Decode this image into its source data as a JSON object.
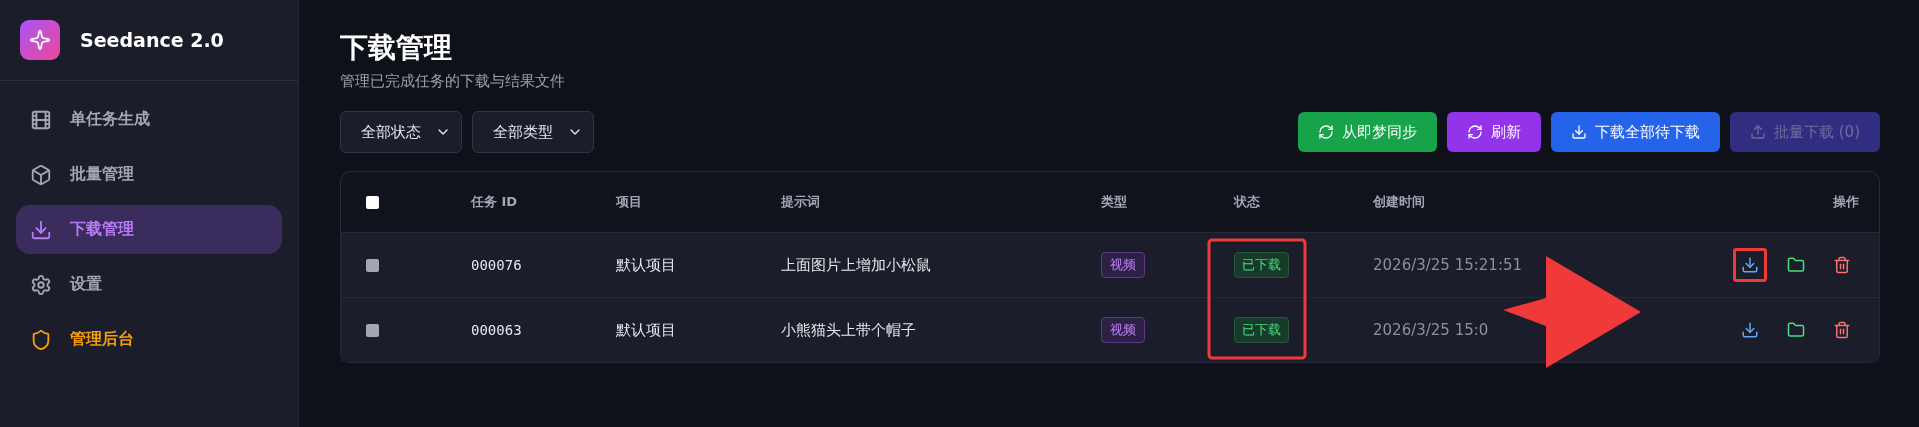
{
  "sidebar": {
    "app_name": "Seedance 2.0",
    "items": [
      {
        "label": "单任务生成",
        "selected": false,
        "kind": "nav"
      },
      {
        "label": "批量管理",
        "selected": false,
        "kind": "nav"
      },
      {
        "label": "下载管理",
        "selected": true,
        "kind": "nav"
      },
      {
        "label": "设置",
        "selected": false,
        "kind": "nav"
      },
      {
        "label": "管理后台",
        "selected": false,
        "kind": "admin"
      }
    ]
  },
  "page": {
    "title": "下载管理",
    "subtitle": "管理已完成任务的下载与结果文件"
  },
  "filters": [
    {
      "value": "全部状态"
    },
    {
      "value": "全部类型"
    }
  ],
  "buttons": [
    {
      "label": "从即梦同步",
      "kind": "sync",
      "color": "#16a34a",
      "disabled": false
    },
    {
      "label": "刷新",
      "kind": "sync",
      "color": "#9333ea",
      "disabled": false
    },
    {
      "label": "下载全部待下载",
      "kind": "download",
      "color": "#2563eb",
      "disabled": false
    },
    {
      "label": "批量下载 (0)",
      "kind": "upload",
      "color": "#312e81",
      "disabled": true
    }
  ],
  "table": {
    "select_all": {
      "checked": false
    },
    "columns": [
      {
        "label": "任务 ID"
      },
      {
        "label": "项目"
      },
      {
        "label": "提示词"
      },
      {
        "label": "类型"
      },
      {
        "label": "状态",
        "highlighted": true
      },
      {
        "label": "创建时间"
      },
      {
        "label": "操作"
      }
    ],
    "rows": [
      {
        "checked": false,
        "id": "000076",
        "project": "默认项目",
        "prompt": "上面图片上增加小松鼠",
        "type": "视频",
        "status": "已下载",
        "created": "2026/3/25 15:21:51",
        "actions": [
          {
            "kind": "download",
            "highlighted": true
          },
          {
            "kind": "folder",
            "highlighted": false
          },
          {
            "kind": "delete",
            "highlighted": false
          }
        ]
      },
      {
        "checked": false,
        "id": "000063",
        "project": "默认项目",
        "prompt": "小熊猫头上带个帽子",
        "type": "视频",
        "status": "已下载",
        "created": "2026/3/25 15:0",
        "actions": [
          {
            "kind": "download",
            "highlighted": false
          },
          {
            "kind": "folder",
            "highlighted": false
          },
          {
            "kind": "delete",
            "highlighted": false
          }
        ]
      }
    ]
  },
  "annotation_arrow": true
}
